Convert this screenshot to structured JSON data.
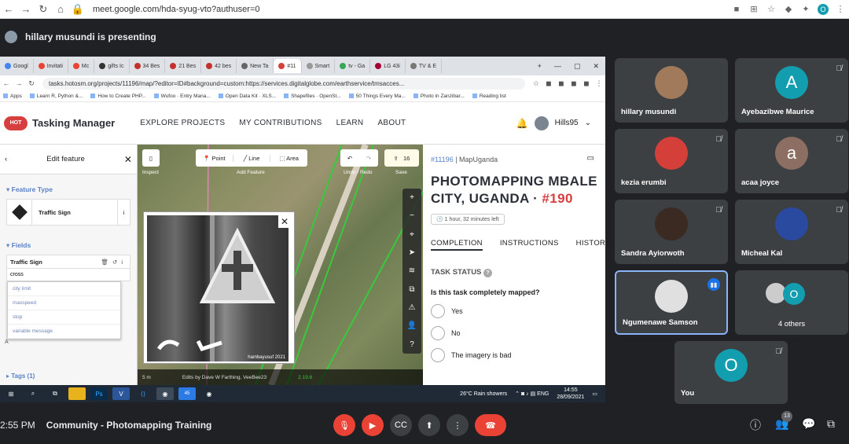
{
  "browser": {
    "url": "meet.google.com/hda-syug-vto?authuser=0",
    "profile_letter": "O"
  },
  "presenter_text": "hillary musundi is presenting",
  "shared": {
    "tabs": [
      "Googl",
      "Invitati",
      "Mc",
      "gifts Ic",
      "34 Bes",
      "21 Bes",
      "42 bes",
      "New Ta",
      "#11",
      "Smart",
      "tv - Ga",
      "LG 43i",
      "TV & E"
    ],
    "url": "tasks.hotosm.org/projects/11196/map/?editor=ID#background=custom:https://services.digitalglobe.com/earthservice/tmsacces...",
    "bookmarks": [
      "Apps",
      "Learn R, Python &...",
      "How to Create PHP...",
      "Wufoo · Entry Mana...",
      "Open Data Kit · XLS...",
      "Shapefiles · OpenSt...",
      "50 Things Every Ma...",
      "Photo in Zanzibar...",
      "Reading list"
    ],
    "tm_logo": "HOT",
    "tm_title": "Tasking Manager",
    "nav": [
      "EXPLORE PROJECTS",
      "MY CONTRIBUTIONS",
      "LEARN",
      "ABOUT"
    ],
    "user": "Hills95",
    "edit": {
      "title": "Edit feature",
      "feature_type_label": "Feature Type",
      "feature_type": "Traffic Sign",
      "fields_label": "Fields",
      "field_name": "Traffic Sign",
      "field_value": "cross",
      "suggestions": [
        "city limit",
        "maxspeed",
        "stop",
        "variable message"
      ],
      "tags_label": "Tags (1)",
      "a_label": "A"
    },
    "map": {
      "inspect": "Inspect",
      "point": "Point",
      "line": "Line",
      "area": "Area",
      "add_feature": "Add Feature",
      "undo_redo": "Undo / Redo",
      "save": "Save",
      "save_count": "16",
      "scale": "5 m",
      "edits": "Edits by Dave W Farthing, VeeBee23",
      "version": "2.19.6",
      "photo_credit": "hambayusuf 2021"
    },
    "task": {
      "project": "#11196",
      "org": "MapUganda",
      "title": "PHOTOMAPPING MBALE CITY, UGANDA",
      "task_id": "#190",
      "time_left": "1 hour, 32 minutes left",
      "tabs": [
        "COMPLETION",
        "INSTRUCTIONS",
        "HISTORY"
      ],
      "status_label": "TASK STATUS",
      "question": "Is this task completely mapped?",
      "options": [
        "Yes",
        "No",
        "The imagery is bad"
      ]
    },
    "taskbar": {
      "weather": "26°C  Rain showers",
      "time": "14:55",
      "date": "28/09/2021",
      "badge": "45"
    }
  },
  "participants": [
    {
      "name": "hillary musundi",
      "type": "photo",
      "muted": false
    },
    {
      "name": "Ayebazibwe Maurice",
      "type": "letter",
      "letter": "A",
      "muted": true
    },
    {
      "name": "kezia erumbi",
      "type": "photo",
      "muted": true
    },
    {
      "name": "acaa joyce",
      "type": "letter",
      "letter": "a",
      "muted": true
    },
    {
      "name": "Sandra Ayiorwoth",
      "type": "photo",
      "muted": true
    },
    {
      "name": "Micheal Kal",
      "type": "photo",
      "muted": true
    },
    {
      "name": "Ngumenawe Samson",
      "type": "photo",
      "muted": false
    },
    {
      "name": "4 others",
      "type": "others",
      "letter": "O"
    },
    {
      "name": "You",
      "type": "letter",
      "letter": "O",
      "muted": true
    }
  ],
  "bottom": {
    "time": "2:55 PM",
    "title": "Community - Photomapping Training",
    "people_count": "13"
  },
  "colors": {
    "accent": "#d73f3f",
    "meet_red": "#ea4335",
    "teal": "#129eaf",
    "brown": "#8d6e63",
    "tm_blue": "#5a82c8",
    "speaker_border": "#8ab4f8"
  }
}
